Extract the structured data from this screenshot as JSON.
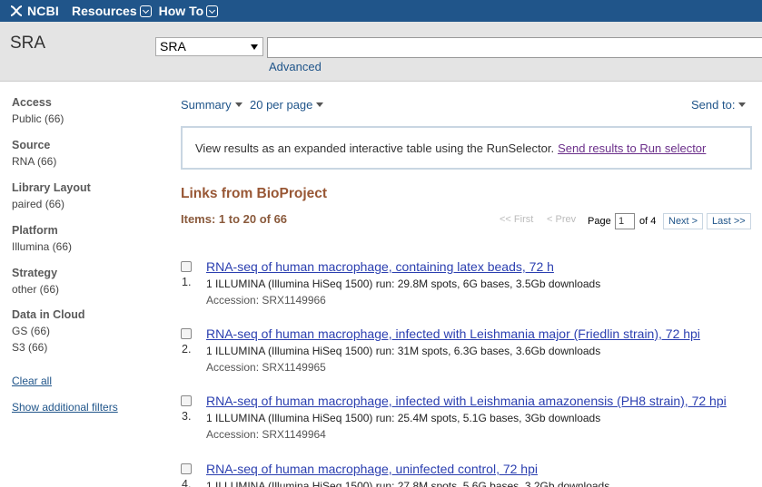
{
  "topbar": {
    "brand": "NCBI",
    "menus": [
      {
        "label": "Resources"
      },
      {
        "label": "How To"
      }
    ]
  },
  "search": {
    "db_title": "SRA",
    "db_selected": "SRA",
    "query": "",
    "advanced_label": "Advanced"
  },
  "filters": [
    {
      "title": "Access",
      "value": "Public (66)"
    },
    {
      "title": "Source",
      "value": "RNA (66)"
    },
    {
      "title": "Library Layout",
      "value": "paired (66)"
    },
    {
      "title": "Platform",
      "value": "Illumina (66)"
    },
    {
      "title": "Strategy",
      "value": "other (66)"
    },
    {
      "title": "Data in Cloud",
      "value": "GS (66)",
      "value2": "S3 (66)"
    }
  ],
  "sidebar_links": {
    "clear_all": "Clear all",
    "show_filters": "Show additional filters"
  },
  "toolbar": {
    "format": "Summary",
    "per_page": "20 per page",
    "send_to": "Send to:"
  },
  "runselector": {
    "text": "View results as an expanded interactive table using the RunSelector.",
    "link": "Send results to Run selector"
  },
  "results_header": {
    "title": "Links from BioProject",
    "items": "Items: 1 to 20 of 66"
  },
  "pager": {
    "first": "<< First",
    "prev": "< Prev",
    "page_label": "Page",
    "page_value": "1",
    "of_label": "of 4",
    "next": "Next >",
    "last": "Last >>"
  },
  "results": [
    {
      "num": "1.",
      "title": "RNA-seq of human macrophage, containing latex beads, 72 h",
      "desc": "1 ILLUMINA (Illumina HiSeq 1500) run: 29.8M spots, 6G bases, 3.5Gb downloads",
      "accession": "Accession: SRX1149966"
    },
    {
      "num": "2.",
      "title": "RNA-seq of human macrophage, infected with Leishmania major (Friedlin strain), 72 hpi",
      "desc": "1 ILLUMINA (Illumina HiSeq 1500) run: 31M spots, 6.3G bases, 3.6Gb downloads",
      "accession": "Accession: SRX1149965"
    },
    {
      "num": "3.",
      "title": "RNA-seq of human macrophage, infected with Leishmania amazonensis (PH8 strain), 72 hpi",
      "desc": "1 ILLUMINA (Illumina HiSeq 1500) run: 25.4M spots, 5.1G bases, 3Gb downloads",
      "accession": "Accession: SRX1149964"
    },
    {
      "num": "4.",
      "title": "RNA-seq of human macrophage, uninfected control, 72 hpi",
      "desc": "1 ILLUMINA (Illumina HiSeq 1500) run: 27.8M spots, 5.6G bases, 3.2Gb downloads",
      "accession": ""
    }
  ]
}
